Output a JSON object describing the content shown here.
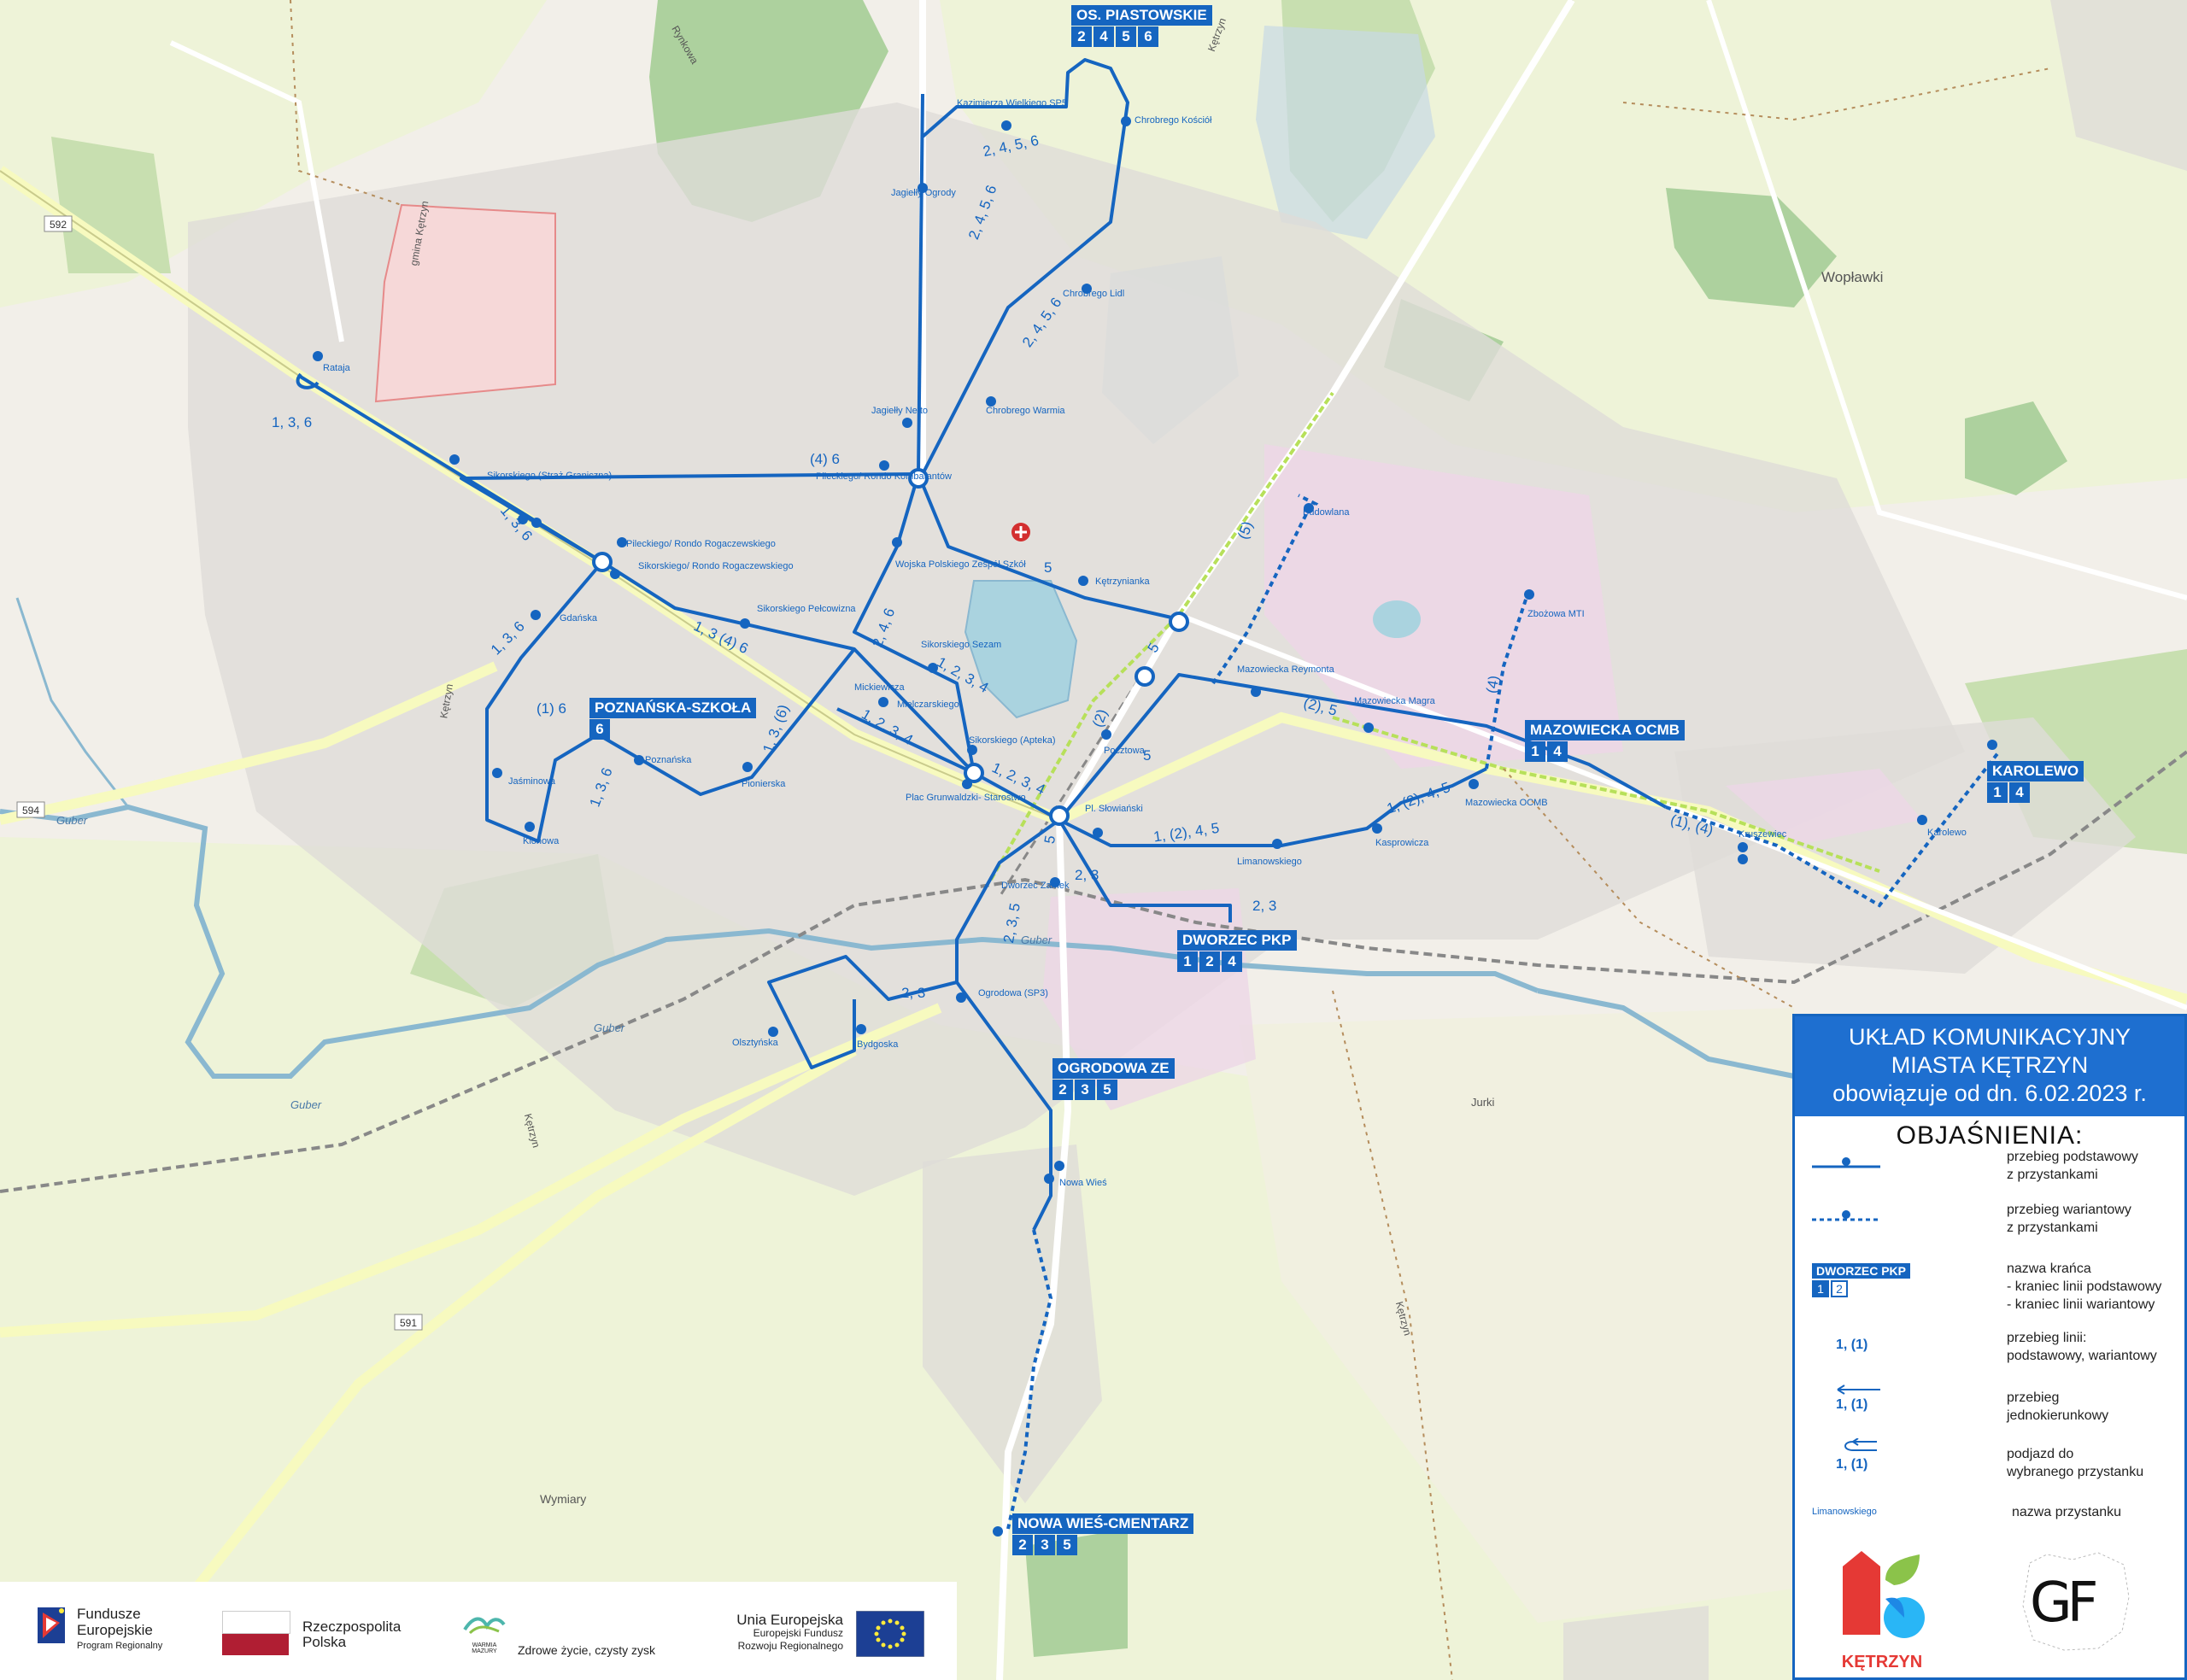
{
  "legend": {
    "header_line1": "UKŁAD KOMUNIKACYJNY",
    "header_line2": "MIASTA KĘTRZYN",
    "header_line3": "obowiązuje od dn. 6.02.2023 r.",
    "title": "OBJAŚNIENIA:",
    "items": [
      {
        "text1": "przebieg podstawowy",
        "text2": "z przystankami"
      },
      {
        "text1": "przebieg wariantowy",
        "text2": "z przystankami"
      },
      {
        "text1": "nazwa krańca",
        "text2": " - kraniec linii podstawowy",
        "text3": " - kraniec linii wariantowy",
        "sample_name": "DWORZEC PKP",
        "sample_lines": [
          "1",
          "2"
        ]
      },
      {
        "text1": "przebieg linii:",
        "text2": "podstawowy, wariantowy",
        "sample": "1, (1)"
      },
      {
        "text1": "przebieg",
        "text2": "jednokierunkowy",
        "sample": "1, (1)"
      },
      {
        "text1": "podjazd do",
        "text2": "wybranego przystanku",
        "sample": "1, (1)"
      },
      {
        "text1": "nazwa przystanku",
        "sample": "Limanowskiego"
      }
    ],
    "logo_city": "KĘTRZYN",
    "logo_gf": "GF"
  },
  "terminals": [
    {
      "name": "OS. PIASTOWSKIE",
      "lines": [
        "2",
        "4",
        "5",
        "6"
      ]
    },
    {
      "name": "POZNAŃSKA-SZKOŁA",
      "lines": [
        "6"
      ]
    },
    {
      "name": "MAZOWIECKA OCMB",
      "lines": [
        "1",
        "4"
      ]
    },
    {
      "name": "KAROLEWO",
      "lines": [
        "1",
        "4"
      ]
    },
    {
      "name": "DWORZEC PKP",
      "lines": [
        "1",
        "2",
        "4"
      ]
    },
    {
      "name": "OGRODOWA ZE",
      "lines": [
        "2",
        "3",
        "5"
      ]
    },
    {
      "name": "NOWA WIEŚ-CMENTARZ",
      "lines": [
        "2",
        "3",
        "5"
      ]
    }
  ],
  "stops": [
    "Rataja",
    "Sikorskiego (Straż Graniczna)",
    "Pileckiego/ Rondo Rogaczewskiego",
    "Sikorskiego/ Rondo Rogaczewskiego",
    "Gdańska",
    "Sikorskiego Pełcowizna",
    "Pileckiego/ Rondo Kombatantów",
    "Wojska Polskiego Zespół Szkół",
    "Jagiełły Netto",
    "Jagiełły Ogrody",
    "Kazimierza Wielkiego SP5",
    "Chrobrego Kościół",
    "Chrobrego Lidl",
    "Chrobrego Warmia",
    "Kętrzynianka",
    "Budowlana",
    "Zbożowa MTI",
    "Mazowiecka Reymonta",
    "Mazowiecka Magra",
    "Mazowiecka OCMB",
    "Kruszewiec",
    "Karolewo",
    "Kasprowicza",
    "Limanowskiego",
    "Pocztowa",
    "Pl. Słowiański",
    "Sikorskiego Sezam",
    "Mickiewicza",
    "Mielczarskiego",
    "Sikorskiego (Apteka)",
    "Plac Grunwaldzki- Starostwo",
    "Pionierska",
    "Poznańska",
    "Jaśminowa",
    "Klonowa",
    "Dworzec Zamek",
    "Ogrodowa (SP3)",
    "Bydgoska",
    "Olsztyńska",
    "Nowa Wieś"
  ],
  "route_labels": [
    "1, 3, 6",
    "(4) 6",
    "1, 3, 6",
    "1, 3, 6",
    "1, 3 (4) 6",
    "(1) 6",
    "1, 3, 6",
    "1, 3, (6)",
    "1, 2, 3, 4",
    "1, 2, 3, 4",
    "1, 2, 3, 4",
    "2, 4, 5, 6",
    "2, 4, 5, 6",
    "2, 4, 5, 6",
    "2, 4, 6",
    "5",
    "5",
    "(5)",
    "5",
    "(2)",
    "5",
    "(2), 5",
    "(4)",
    "1, (2), 4, 5",
    "1, (2), 4, 5",
    "(1), (4)",
    "2, 3",
    "2, 3",
    "2, 3",
    "2, 3, 5"
  ],
  "place_names": [
    "Wopławki",
    "Wymiary",
    "Guber",
    "Guber",
    "Guber",
    "Guber",
    "Rynkowa",
    "Kętrzyn",
    "gmina Kętrzyn",
    "Kętrzyn",
    "Kętrzyn",
    "Kętrzyn",
    "Jurki"
  ],
  "road_numbers": [
    "592",
    "594",
    "591"
  ],
  "footer": {
    "fe_line1": "Fundusze",
    "fe_line2": "Europejskie",
    "fe_line3": "Program Regionalny",
    "rp_line1": "Rzeczpospolita",
    "rp_line2": "Polska",
    "wm_line1": "WARMIA",
    "wm_line2": "MAZURY",
    "slogan": "Zdrowe życie, czysty zysk",
    "ue_line1": "Unia Europejska",
    "ue_line2": "Europejski Fundusz",
    "ue_line3": "Rozwoju Regionalnego"
  },
  "colors": {
    "route": "#1565c0",
    "terminal": "#1565c0",
    "legend_header": "#1e6fd0",
    "rail": "#b7e05a"
  }
}
